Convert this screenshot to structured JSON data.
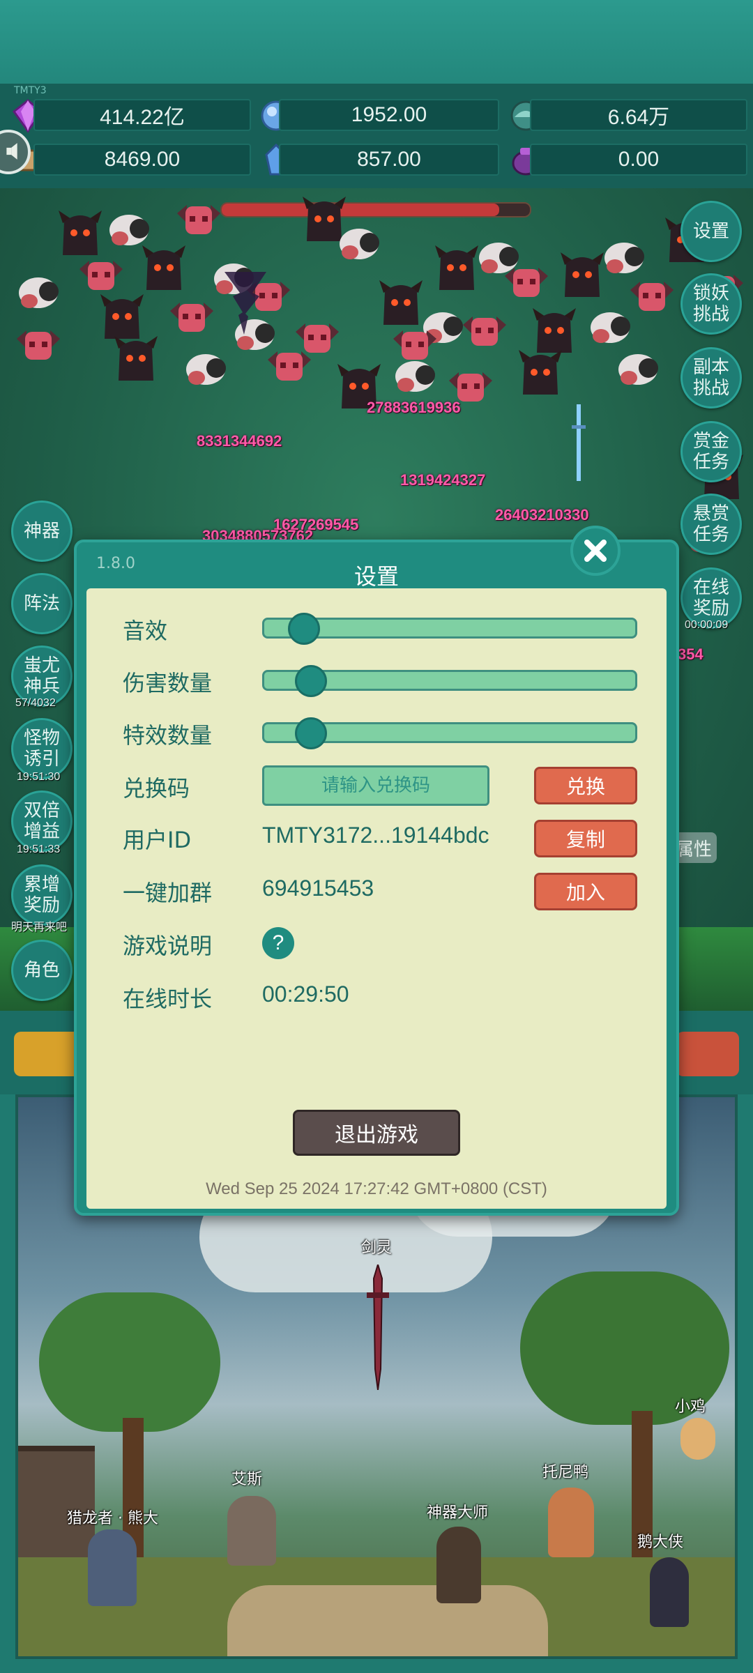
{
  "top_tag": "TMTY3",
  "resources": [
    {
      "icon": "purple-gem-icon",
      "value": "414.22亿"
    },
    {
      "icon": "blue-crystal-icon",
      "value": "1952.00"
    },
    {
      "icon": "teal-orb-icon",
      "value": "6.64万"
    },
    {
      "icon": "scroll-icon",
      "value": "8469.00"
    },
    {
      "icon": "ice-shard-icon",
      "value": "857.00"
    },
    {
      "icon": "purple-pouch-icon",
      "value": "0.00"
    }
  ],
  "boss_hp_fraction": 0.9,
  "damage_numbers": [
    "27883619936",
    "8331344692",
    "1319424327",
    "26403210330",
    "1627269545",
    "3034880573762",
    "354"
  ],
  "side_left": [
    {
      "label": "神器"
    },
    {
      "label": "阵法"
    },
    {
      "label": "蚩尤神兵",
      "sub": "57/4032"
    },
    {
      "label": "怪物诱引",
      "sub": "19:51:30"
    },
    {
      "label": "双倍增益",
      "sub": "19:51:33"
    },
    {
      "label": "累增奖励",
      "sub": "明天再来吧"
    },
    {
      "label": "角色"
    }
  ],
  "side_right": [
    {
      "label": "设置"
    },
    {
      "label": "锁妖挑战"
    },
    {
      "label": "副本挑战"
    },
    {
      "label": "赏金任务"
    },
    {
      "label": "悬赏任务"
    },
    {
      "label": "在线奖励",
      "sub": "00:00:09"
    }
  ],
  "attr_tag": "属性",
  "dialog": {
    "version": "1.8.0",
    "title": "设置",
    "sound_label": "音效",
    "sound_level": 0.07,
    "damage_count_label": "伤害数量",
    "damage_count_level": 0.09,
    "effects_label": "特效数量",
    "effects_level": 0.09,
    "redeem_label": "兑换码",
    "redeem_placeholder": "请输入兑换码",
    "redeem_button": "兑换",
    "user_id_label": "用户ID",
    "user_id_value": "TMTY3172...19144bdc",
    "copy_button": "复制",
    "group_label": "一键加群",
    "group_value": "694915453",
    "join_button": "加入",
    "guide_label": "游戏说明",
    "guide_icon": "?",
    "online_label": "在线时长",
    "online_value": "00:29:50",
    "exit_button": "退出游戏",
    "timestamp": "Wed Sep 25 2024 17:27:42 GMT+0800 (CST)"
  },
  "scene": {
    "sword_label": "剑灵",
    "npcs": [
      "猎龙者 · 熊大",
      "艾斯",
      "神器大师",
      "托尼鸭",
      "小鸡",
      "鹅大侠"
    ]
  },
  "colors": {
    "primary_teal": "#1f8c80",
    "panel_bg": "#e8ecc4",
    "button_red": "#e06a4e",
    "damage_pink": "#ff5aa8"
  }
}
